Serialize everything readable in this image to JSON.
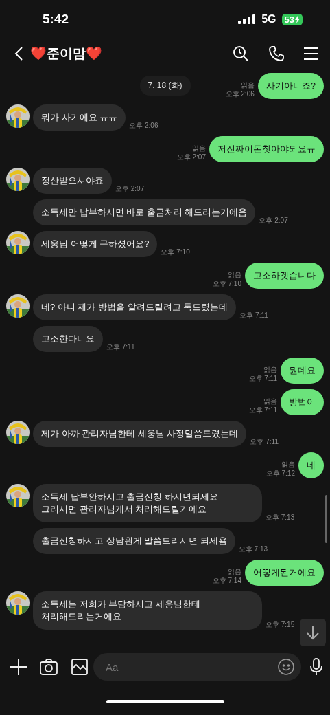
{
  "status_bar": {
    "time": "5:42",
    "network": "5G",
    "battery": "53",
    "charging": true
  },
  "header": {
    "title": "❤️준이맘❤️"
  },
  "date_pill": "7. 18 (화)",
  "messages": [
    {
      "kind": "out",
      "text": "사기아니죠?",
      "read": "읽음",
      "time": "오후 2:06"
    },
    {
      "kind": "in",
      "avatar": true,
      "text": "뭐가 사기에요 ㅠㅠ",
      "time": "오후 2:06"
    },
    {
      "kind": "out",
      "text": "저진짜이돈찻아야되요ㅠ",
      "read": "읽음",
      "time": "오후 2:07"
    },
    {
      "kind": "in",
      "avatar": true,
      "text": "정산받으셔야죠",
      "time": "오후 2:07"
    },
    {
      "kind": "in",
      "avatar": false,
      "text": "소득세만 납부하시면 바로 출금처리 해드리는거에욤",
      "time": "오후 2:07"
    },
    {
      "kind": "in",
      "avatar": true,
      "text": "세웅님 어떻게 구하셨어요?",
      "time": "오후 7:10"
    },
    {
      "kind": "out",
      "text": "고소하겟습니다",
      "read": "읽음",
      "time": "오후 7:10"
    },
    {
      "kind": "in",
      "avatar": true,
      "text": "네? 아니 제가 방법을 알려드릴려고 톡드렸는데",
      "time": "오후 7:11"
    },
    {
      "kind": "in",
      "avatar": false,
      "text": "고소한다니요",
      "time": "오후 7:11"
    },
    {
      "kind": "out",
      "text": "뭔데요",
      "read": "읽음",
      "time": "오후 7:11"
    },
    {
      "kind": "out",
      "text": "방법이",
      "read": "읽음",
      "time": "오후 7:11"
    },
    {
      "kind": "in",
      "avatar": true,
      "text": "제가 아까 관리자님한테 세웅님 사정말씀드렸는데",
      "time": "오후 7:11"
    },
    {
      "kind": "out",
      "text": "네",
      "read": "읽음",
      "time": "오후 7:12"
    },
    {
      "kind": "in",
      "avatar": true,
      "text": "소득세 납부안하시고 출금신청 하시면되세요 그러시면 관리자님게서 처리해드릴거에요",
      "time": "오후 7:13"
    },
    {
      "kind": "in",
      "avatar": false,
      "text": "출금신청하시고 상담원게 말씀드리시면 되세욤",
      "time": "오후 7:13"
    },
    {
      "kind": "out",
      "text": "어떻게된거에요",
      "read": "읽음",
      "time": "오후 7:14"
    },
    {
      "kind": "in",
      "avatar": true,
      "text": "소득세는 저희가 부담하시고 세웅님한테 처리해드리는거에요",
      "time": "오후 7:15"
    }
  ],
  "composer": {
    "placeholder": "Aa"
  }
}
